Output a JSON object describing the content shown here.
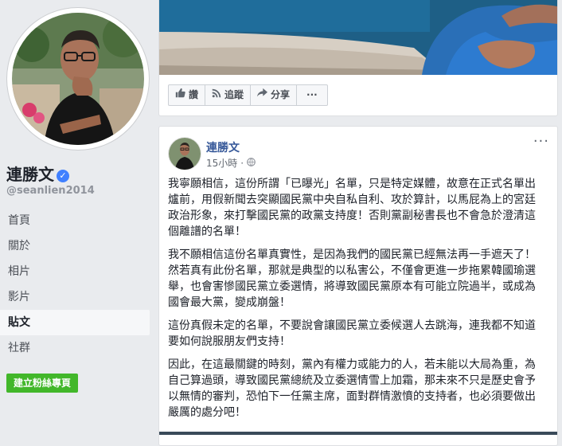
{
  "page": {
    "name": "連勝文",
    "handle": "@seanlien2014",
    "verified_glyph": "✓"
  },
  "nav": {
    "items": [
      {
        "label": "首頁",
        "active": false
      },
      {
        "label": "關於",
        "active": false
      },
      {
        "label": "相片",
        "active": false
      },
      {
        "label": "影片",
        "active": false
      },
      {
        "label": "貼文",
        "active": true
      },
      {
        "label": "社群",
        "active": false
      }
    ],
    "create_page_label": "建立粉絲專頁"
  },
  "actions": {
    "like_label": "讚",
    "follow_label": "追蹤",
    "share_label": "分享",
    "more_label": "···"
  },
  "icons": {
    "like": "thumbs-up-icon",
    "follow": "rss-icon",
    "share": "share-arrow-icon",
    "audience": "globe-icon",
    "verified": "verified-badge-icon"
  },
  "post": {
    "author": "連勝文",
    "time": "15小時",
    "separator": "·",
    "more_label": "···",
    "paragraphs": [
      "我寧願相信，這份所謂「已曝光」名單，只是特定媒體，故意在正式名單出爐前，用假新聞去突顯國民黨中央自私自利、攻於算計，以馬屁為上的宮廷政治形象，來打擊國民黨的政黨支持度！否則黨副秘書長也不會急於澄清這個離譜的名單！",
      "我不願相信這份名單真實性，是因為我們的國民黨已經無法再一手遮天了！然若真有此份名單，那就是典型的以私害公，不僅會更進一步拖累韓國瑜選舉，也會害慘國民黨立委選情，將導致國民黨原本有可能立院過半，或成為國會最大黨，變成崩盤！",
      "這份真假未定的名單，不要說會讓國民黨立委候選人去跳海，連我都不知道要如何說服朋友們支持！",
      "因此，在這最關鍵的時刻，黨內有權力或能力的人，若未能以大局為重，為自己算過頭，導致國民黨總統及立委選情雪上加霜，那未來不只是歷史會予以無情的審判，恐怕下一任黨主席，面對群情激憤的支持者，也必須要做出嚴厲的處分吧！"
    ]
  },
  "colors": {
    "link": "#365899",
    "create_button": "#42b72a",
    "verified": "#4080ff",
    "background": "#e9ebee"
  }
}
